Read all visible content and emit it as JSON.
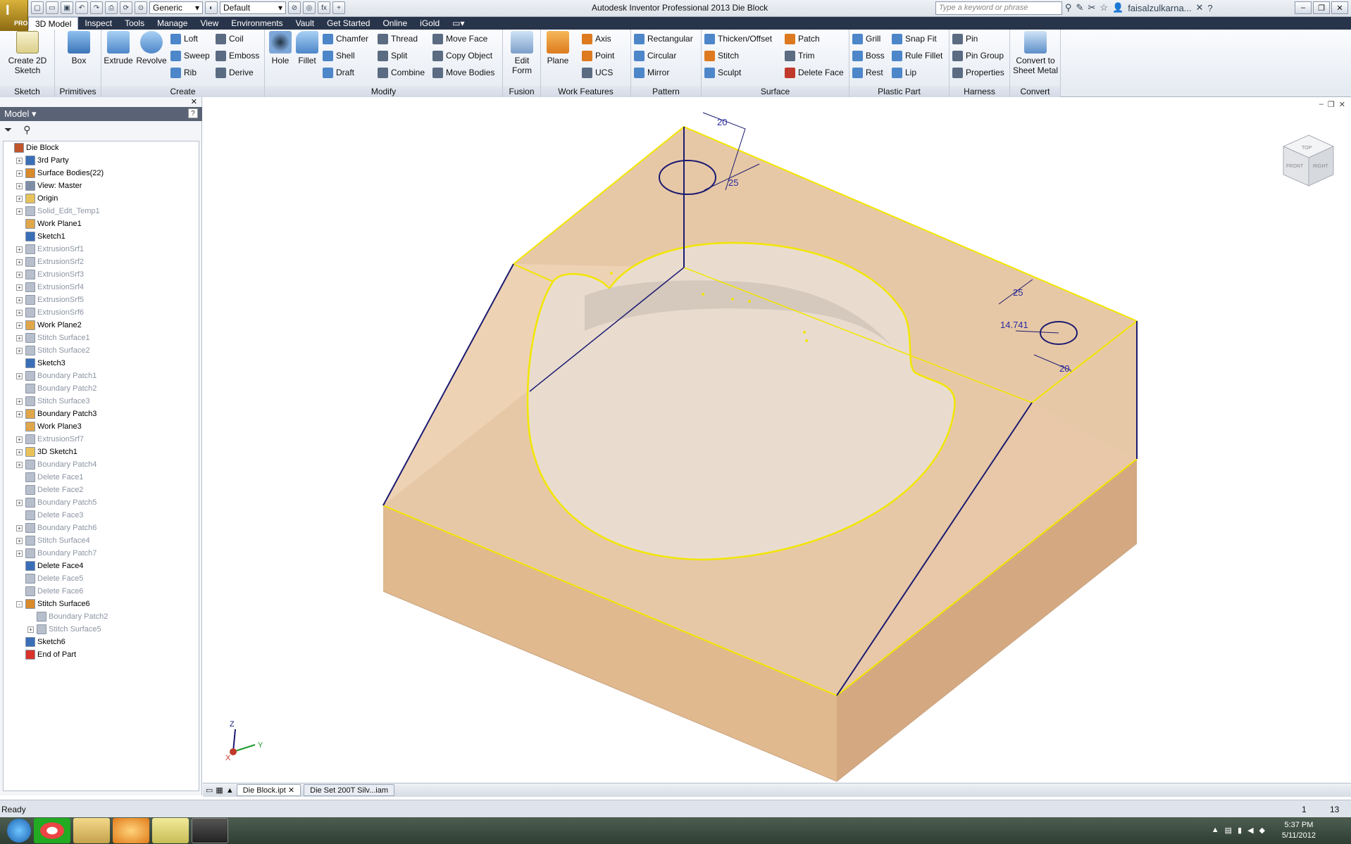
{
  "window": {
    "title": "Autodesk Inventor Professional 2013   Die Block"
  },
  "app_button": {
    "badge": "PRO"
  },
  "quick_access": {
    "material": "Generic",
    "appearance": "Default",
    "fx": "fx"
  },
  "search": {
    "placeholder": "Type a keyword or phrase"
  },
  "user": {
    "name": "faisalzulkarna..."
  },
  "tabs": [
    "3D Model",
    "Inspect",
    "Tools",
    "Manage",
    "View",
    "Environments",
    "Vault",
    "Get Started",
    "Online",
    "iGold"
  ],
  "ribbon": {
    "sketch": {
      "label": "Sketch",
      "create_2d": "Create 2D Sketch"
    },
    "primitives": {
      "label": "Primitives",
      "box": "Box"
    },
    "create": {
      "label": "Create",
      "extrude": "Extrude",
      "revolve": "Revolve",
      "loft": "Loft",
      "sweep": "Sweep",
      "rib": "Rib",
      "coil": "Coil",
      "emboss": "Emboss",
      "derive": "Derive"
    },
    "modify": {
      "label": "Modify",
      "hole": "Hole",
      "fillet": "Fillet",
      "chamfer": "Chamfer",
      "shell": "Shell",
      "draft": "Draft",
      "thread": "Thread",
      "split": "Split",
      "combine": "Combine",
      "move_face": "Move Face",
      "copy_object": "Copy Object",
      "move_bodies": "Move Bodies"
    },
    "fusion": {
      "label": "Fusion",
      "edit_form": "Edit Form"
    },
    "work_features": {
      "label": "Work Features",
      "plane": "Plane",
      "axis": "Axis",
      "point": "Point",
      "ucs": "UCS"
    },
    "pattern": {
      "label": "Pattern",
      "rectangular": "Rectangular",
      "circular": "Circular",
      "mirror": "Mirror"
    },
    "surface": {
      "label": "Surface",
      "thicken": "Thicken/Offset",
      "stitch": "Stitch",
      "sculpt": "Sculpt",
      "patch": "Patch",
      "trim": "Trim",
      "delete_face": "Delete Face"
    },
    "plastic": {
      "label": "Plastic Part",
      "grill": "Grill",
      "boss": "Boss",
      "rest": "Rest",
      "snap_fit": "Snap Fit",
      "rule_fillet": "Rule Fillet",
      "lip": "Lip"
    },
    "harness": {
      "label": "Harness",
      "pin": "Pin",
      "pin_group": "Pin Group",
      "properties": "Properties"
    },
    "convert": {
      "label": "Convert",
      "sheet_metal": "Convert to Sheet Metal"
    }
  },
  "browser": {
    "title": "Model",
    "nodes": [
      {
        "label": "Die Block",
        "exp": "",
        "dim": false,
        "indent": 0,
        "color": "#c0552c"
      },
      {
        "label": "3rd Party",
        "exp": "+",
        "dim": false,
        "indent": 1,
        "color": "#3a6fb7"
      },
      {
        "label": "Surface Bodies(22)",
        "exp": "+",
        "dim": false,
        "indent": 1,
        "color": "#d98a2b"
      },
      {
        "label": "View: Master",
        "exp": "+",
        "dim": false,
        "indent": 1,
        "color": "#7f8ea6"
      },
      {
        "label": "Origin",
        "exp": "+",
        "dim": false,
        "indent": 1,
        "color": "#e8c25a"
      },
      {
        "label": "Solid_Edit_Temp1",
        "exp": "+",
        "dim": true,
        "indent": 1,
        "color": "#b8bfcc"
      },
      {
        "label": "Work Plane1",
        "exp": "",
        "dim": false,
        "indent": 1,
        "color": "#e0a64a"
      },
      {
        "label": "Sketch1",
        "exp": "",
        "dim": false,
        "indent": 1,
        "color": "#3a6fb7"
      },
      {
        "label": "ExtrusionSrf1",
        "exp": "+",
        "dim": true,
        "indent": 1,
        "color": "#b8bfcc"
      },
      {
        "label": "ExtrusionSrf2",
        "exp": "+",
        "dim": true,
        "indent": 1,
        "color": "#b8bfcc"
      },
      {
        "label": "ExtrusionSrf3",
        "exp": "+",
        "dim": true,
        "indent": 1,
        "color": "#b8bfcc"
      },
      {
        "label": "ExtrusionSrf4",
        "exp": "+",
        "dim": true,
        "indent": 1,
        "color": "#b8bfcc"
      },
      {
        "label": "ExtrusionSrf5",
        "exp": "+",
        "dim": true,
        "indent": 1,
        "color": "#b8bfcc"
      },
      {
        "label": "ExtrusionSrf6",
        "exp": "+",
        "dim": true,
        "indent": 1,
        "color": "#b8bfcc"
      },
      {
        "label": "Work Plane2",
        "exp": "+",
        "dim": false,
        "indent": 1,
        "color": "#e0a64a"
      },
      {
        "label": "Stitch Surface1",
        "exp": "+",
        "dim": true,
        "indent": 1,
        "color": "#b8bfcc"
      },
      {
        "label": "Stitch Surface2",
        "exp": "+",
        "dim": true,
        "indent": 1,
        "color": "#b8bfcc"
      },
      {
        "label": "Sketch3",
        "exp": "",
        "dim": false,
        "indent": 1,
        "color": "#3a6fb7"
      },
      {
        "label": "Boundary Patch1",
        "exp": "+",
        "dim": true,
        "indent": 1,
        "color": "#b8bfcc"
      },
      {
        "label": "Boundary Patch2",
        "exp": "",
        "dim": true,
        "indent": 1,
        "color": "#b8bfcc"
      },
      {
        "label": "Stitch Surface3",
        "exp": "+",
        "dim": true,
        "indent": 1,
        "color": "#b8bfcc"
      },
      {
        "label": "Boundary Patch3",
        "exp": "+",
        "dim": false,
        "indent": 1,
        "color": "#e0a64a"
      },
      {
        "label": "Work Plane3",
        "exp": "",
        "dim": false,
        "indent": 1,
        "color": "#e0a64a"
      },
      {
        "label": "ExtrusionSrf7",
        "exp": "+",
        "dim": true,
        "indent": 1,
        "color": "#b8bfcc"
      },
      {
        "label": "3D Sketch1",
        "exp": "+",
        "dim": false,
        "indent": 1,
        "color": "#e8c25a"
      },
      {
        "label": "Boundary Patch4",
        "exp": "+",
        "dim": true,
        "indent": 1,
        "color": "#b8bfcc"
      },
      {
        "label": "Delete Face1",
        "exp": "",
        "dim": true,
        "indent": 1,
        "color": "#b8bfcc"
      },
      {
        "label": "Delete Face2",
        "exp": "",
        "dim": true,
        "indent": 1,
        "color": "#b8bfcc"
      },
      {
        "label": "Boundary Patch5",
        "exp": "+",
        "dim": true,
        "indent": 1,
        "color": "#b8bfcc"
      },
      {
        "label": "Delete Face3",
        "exp": "",
        "dim": true,
        "indent": 1,
        "color": "#b8bfcc"
      },
      {
        "label": "Boundary Patch6",
        "exp": "+",
        "dim": true,
        "indent": 1,
        "color": "#b8bfcc"
      },
      {
        "label": "Stitch Surface4",
        "exp": "+",
        "dim": true,
        "indent": 1,
        "color": "#b8bfcc"
      },
      {
        "label": "Boundary Patch7",
        "exp": "+",
        "dim": true,
        "indent": 1,
        "color": "#b8bfcc"
      },
      {
        "label": "Delete Face4",
        "exp": "",
        "dim": false,
        "indent": 1,
        "color": "#3a6fb7"
      },
      {
        "label": "Delete Face5",
        "exp": "",
        "dim": true,
        "indent": 1,
        "color": "#b8bfcc"
      },
      {
        "label": "Delete Face6",
        "exp": "",
        "dim": true,
        "indent": 1,
        "color": "#b8bfcc"
      },
      {
        "label": "Stitch Surface6",
        "exp": "-",
        "dim": false,
        "indent": 1,
        "color": "#d98a2b"
      },
      {
        "label": "Boundary Patch2",
        "exp": "",
        "dim": true,
        "indent": 2,
        "color": "#b8bfcc"
      },
      {
        "label": "Stitch Surface5",
        "exp": "+",
        "dim": true,
        "indent": 2,
        "color": "#b8bfcc"
      },
      {
        "label": "Sketch6",
        "exp": "",
        "dim": false,
        "indent": 1,
        "color": "#3a6fb7"
      },
      {
        "label": "End of Part",
        "exp": "",
        "dim": false,
        "indent": 1,
        "color": "#d9332b"
      }
    ]
  },
  "dimensions": {
    "d1": "20",
    "d2": "25",
    "d3": "25",
    "d4": "14.741",
    "d5": "20."
  },
  "axes": {
    "x": "X",
    "y": "Y",
    "z": "Z"
  },
  "viewcube": {
    "top": "TOP",
    "front": "FRONT",
    "right": "RIGHT"
  },
  "doc_tabs": [
    "Die Block.ipt",
    "Die Set 200T Silv...iam"
  ],
  "status": {
    "text": "Ready",
    "count1": "1",
    "count2": "13"
  },
  "clock": {
    "time": "5:37 PM",
    "date": "5/11/2012"
  },
  "colors": {
    "face": "#e3c3a0",
    "edge": "#f2e600",
    "sketch": "#1a1a70"
  }
}
